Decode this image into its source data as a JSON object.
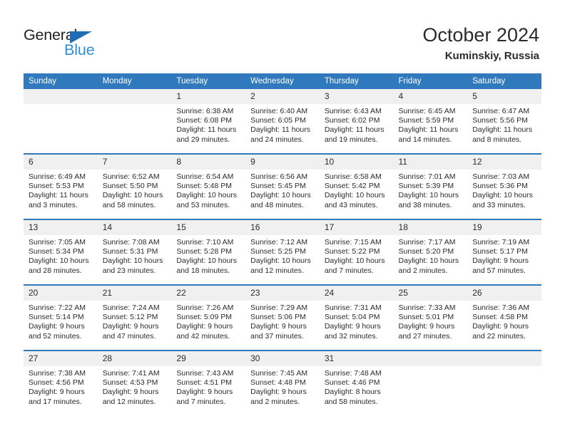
{
  "brand": {
    "name_top": "General",
    "name_bottom": "Blue",
    "triangle_icon": "triangle-logo-icon",
    "color_dark": "#231f20",
    "color_blue": "#2f8fd4",
    "color_triangle": "#1f6db4"
  },
  "header": {
    "title": "October 2024",
    "subtitle": "Kuminskiy, Russia"
  },
  "theme": {
    "header_blue": "#3079bd",
    "daynum_band": "#f0f0f0",
    "text": "#2b2b2b"
  },
  "weekdays": [
    {
      "label": "Sunday"
    },
    {
      "label": "Monday"
    },
    {
      "label": "Tuesday"
    },
    {
      "label": "Wednesday"
    },
    {
      "label": "Thursday"
    },
    {
      "label": "Friday"
    },
    {
      "label": "Saturday"
    }
  ],
  "weeks": [
    [
      {
        "day": "",
        "empty": true
      },
      {
        "day": "",
        "empty": true
      },
      {
        "day": "1",
        "sunrise": "Sunrise: 6:38 AM",
        "sunset": "Sunset: 6:08 PM",
        "daylight": "Daylight: 11 hours and 29 minutes."
      },
      {
        "day": "2",
        "sunrise": "Sunrise: 6:40 AM",
        "sunset": "Sunset: 6:05 PM",
        "daylight": "Daylight: 11 hours and 24 minutes."
      },
      {
        "day": "3",
        "sunrise": "Sunrise: 6:43 AM",
        "sunset": "Sunset: 6:02 PM",
        "daylight": "Daylight: 11 hours and 19 minutes."
      },
      {
        "day": "4",
        "sunrise": "Sunrise: 6:45 AM",
        "sunset": "Sunset: 5:59 PM",
        "daylight": "Daylight: 11 hours and 14 minutes."
      },
      {
        "day": "5",
        "sunrise": "Sunrise: 6:47 AM",
        "sunset": "Sunset: 5:56 PM",
        "daylight": "Daylight: 11 hours and 8 minutes."
      }
    ],
    [
      {
        "day": "6",
        "sunrise": "Sunrise: 6:49 AM",
        "sunset": "Sunset: 5:53 PM",
        "daylight": "Daylight: 11 hours and 3 minutes."
      },
      {
        "day": "7",
        "sunrise": "Sunrise: 6:52 AM",
        "sunset": "Sunset: 5:50 PM",
        "daylight": "Daylight: 10 hours and 58 minutes."
      },
      {
        "day": "8",
        "sunrise": "Sunrise: 6:54 AM",
        "sunset": "Sunset: 5:48 PM",
        "daylight": "Daylight: 10 hours and 53 minutes."
      },
      {
        "day": "9",
        "sunrise": "Sunrise: 6:56 AM",
        "sunset": "Sunset: 5:45 PM",
        "daylight": "Daylight: 10 hours and 48 minutes."
      },
      {
        "day": "10",
        "sunrise": "Sunrise: 6:58 AM",
        "sunset": "Sunset: 5:42 PM",
        "daylight": "Daylight: 10 hours and 43 minutes."
      },
      {
        "day": "11",
        "sunrise": "Sunrise: 7:01 AM",
        "sunset": "Sunset: 5:39 PM",
        "daylight": "Daylight: 10 hours and 38 minutes."
      },
      {
        "day": "12",
        "sunrise": "Sunrise: 7:03 AM",
        "sunset": "Sunset: 5:36 PM",
        "daylight": "Daylight: 10 hours and 33 minutes."
      }
    ],
    [
      {
        "day": "13",
        "sunrise": "Sunrise: 7:05 AM",
        "sunset": "Sunset: 5:34 PM",
        "daylight": "Daylight: 10 hours and 28 minutes."
      },
      {
        "day": "14",
        "sunrise": "Sunrise: 7:08 AM",
        "sunset": "Sunset: 5:31 PM",
        "daylight": "Daylight: 10 hours and 23 minutes."
      },
      {
        "day": "15",
        "sunrise": "Sunrise: 7:10 AM",
        "sunset": "Sunset: 5:28 PM",
        "daylight": "Daylight: 10 hours and 18 minutes."
      },
      {
        "day": "16",
        "sunrise": "Sunrise: 7:12 AM",
        "sunset": "Sunset: 5:25 PM",
        "daylight": "Daylight: 10 hours and 12 minutes."
      },
      {
        "day": "17",
        "sunrise": "Sunrise: 7:15 AM",
        "sunset": "Sunset: 5:22 PM",
        "daylight": "Daylight: 10 hours and 7 minutes."
      },
      {
        "day": "18",
        "sunrise": "Sunrise: 7:17 AM",
        "sunset": "Sunset: 5:20 PM",
        "daylight": "Daylight: 10 hours and 2 minutes."
      },
      {
        "day": "19",
        "sunrise": "Sunrise: 7:19 AM",
        "sunset": "Sunset: 5:17 PM",
        "daylight": "Daylight: 9 hours and 57 minutes."
      }
    ],
    [
      {
        "day": "20",
        "sunrise": "Sunrise: 7:22 AM",
        "sunset": "Sunset: 5:14 PM",
        "daylight": "Daylight: 9 hours and 52 minutes."
      },
      {
        "day": "21",
        "sunrise": "Sunrise: 7:24 AM",
        "sunset": "Sunset: 5:12 PM",
        "daylight": "Daylight: 9 hours and 47 minutes."
      },
      {
        "day": "22",
        "sunrise": "Sunrise: 7:26 AM",
        "sunset": "Sunset: 5:09 PM",
        "daylight": "Daylight: 9 hours and 42 minutes."
      },
      {
        "day": "23",
        "sunrise": "Sunrise: 7:29 AM",
        "sunset": "Sunset: 5:06 PM",
        "daylight": "Daylight: 9 hours and 37 minutes."
      },
      {
        "day": "24",
        "sunrise": "Sunrise: 7:31 AM",
        "sunset": "Sunset: 5:04 PM",
        "daylight": "Daylight: 9 hours and 32 minutes."
      },
      {
        "day": "25",
        "sunrise": "Sunrise: 7:33 AM",
        "sunset": "Sunset: 5:01 PM",
        "daylight": "Daylight: 9 hours and 27 minutes."
      },
      {
        "day": "26",
        "sunrise": "Sunrise: 7:36 AM",
        "sunset": "Sunset: 4:58 PM",
        "daylight": "Daylight: 9 hours and 22 minutes."
      }
    ],
    [
      {
        "day": "27",
        "sunrise": "Sunrise: 7:38 AM",
        "sunset": "Sunset: 4:56 PM",
        "daylight": "Daylight: 9 hours and 17 minutes."
      },
      {
        "day": "28",
        "sunrise": "Sunrise: 7:41 AM",
        "sunset": "Sunset: 4:53 PM",
        "daylight": "Daylight: 9 hours and 12 minutes."
      },
      {
        "day": "29",
        "sunrise": "Sunrise: 7:43 AM",
        "sunset": "Sunset: 4:51 PM",
        "daylight": "Daylight: 9 hours and 7 minutes."
      },
      {
        "day": "30",
        "sunrise": "Sunrise: 7:45 AM",
        "sunset": "Sunset: 4:48 PM",
        "daylight": "Daylight: 9 hours and 2 minutes."
      },
      {
        "day": "31",
        "sunrise": "Sunrise: 7:48 AM",
        "sunset": "Sunset: 4:46 PM",
        "daylight": "Daylight: 8 hours and 58 minutes."
      },
      {
        "day": "",
        "empty": true
      },
      {
        "day": "",
        "empty": true
      }
    ]
  ]
}
